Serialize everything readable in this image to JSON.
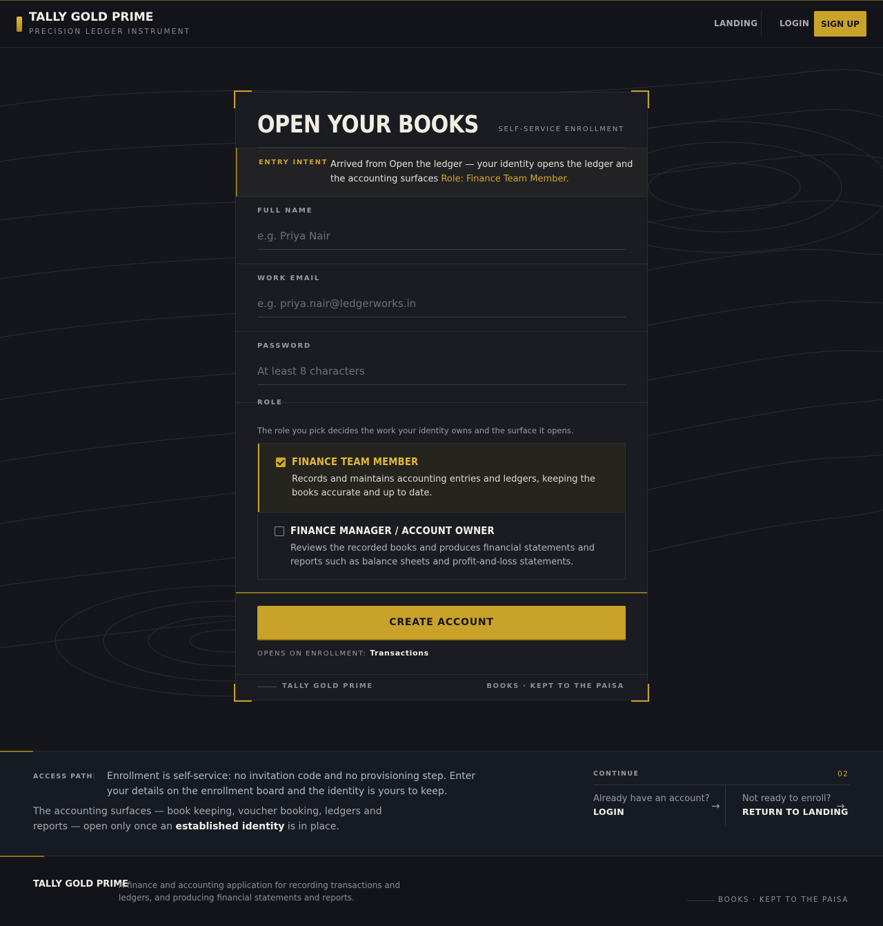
{
  "header": {
    "brand_name": "TALLY GOLD PRIME",
    "brand_sub": "PRECISION LEDGER INSTRUMENT",
    "nav": {
      "landing": "LANDING",
      "login": "LOGIN",
      "signup": "SIGN UP"
    }
  },
  "card": {
    "title": "OPEN YOUR BOOKS",
    "tag": "SELF-SERVICE ENROLLMENT",
    "intent": {
      "label": "ENTRY INTENT",
      "text": "Arrived from Open the ledger — your identity opens the ledger and the accounting surfaces",
      "role": "Role: Finance Team Member."
    },
    "fields": {
      "full_name": {
        "label": "FULL NAME",
        "placeholder": "e.g. Priya Nair",
        "value": ""
      },
      "work_email": {
        "label": "WORK EMAIL",
        "placeholder": "e.g. priya.nair@ledgerworks.in",
        "value": ""
      },
      "password": {
        "label": "PASSWORD",
        "placeholder": "At least 8 characters",
        "value": ""
      }
    },
    "role": {
      "label": "ROLE",
      "help": "The role you pick decides the work your identity owns and the surface it opens.",
      "options": [
        {
          "title": "FINANCE TEAM MEMBER",
          "desc": "Records and maintains accounting entries and ledgers, keeping the books accurate and up to date.",
          "selected": true
        },
        {
          "title": "FINANCE MANAGER / ACCOUNT OWNER",
          "desc": "Reviews the recorded books and produces financial statements and reports such as balance sheets and profit-and-loss statements.",
          "selected": false
        }
      ]
    },
    "create_button": "CREATE ACCOUNT",
    "opens_label": "OPENS ON ENROLLMENT:",
    "opens_value": "Transactions",
    "footer_left": "TALLY GOLD PRIME",
    "footer_right": "BOOKS · KEPT TO THE PAISA"
  },
  "access": {
    "label": "ACCESS PATH",
    "text1": "Enrollment is self-service: no invitation code and no provisioning step. Enter your details on the enrollment board and the identity is yours to keep.",
    "text2_pre": "The accounting surfaces — book keeping, voucher booking, ledgers and reports — open only once an ",
    "text2_bold": "established identity",
    "text2_post": " is in place.",
    "continue_label": "CONTINUE",
    "continue_num": "02",
    "login_q": "Already have an account?",
    "login_a": "LOGIN",
    "landing_q": "Not ready to enroll?",
    "landing_a": "RETURN TO LANDING"
  },
  "footer": {
    "brand": "TALLY GOLD PRIME",
    "desc": "A finance and accounting application for recording transactions and ledgers, and producing financial statements and reports.",
    "tag": "BOOKS · KEPT TO THE PAISA"
  },
  "colors": {
    "accent_gold": "#c9a229",
    "background": "#15161b",
    "card": "#1a1c21"
  }
}
